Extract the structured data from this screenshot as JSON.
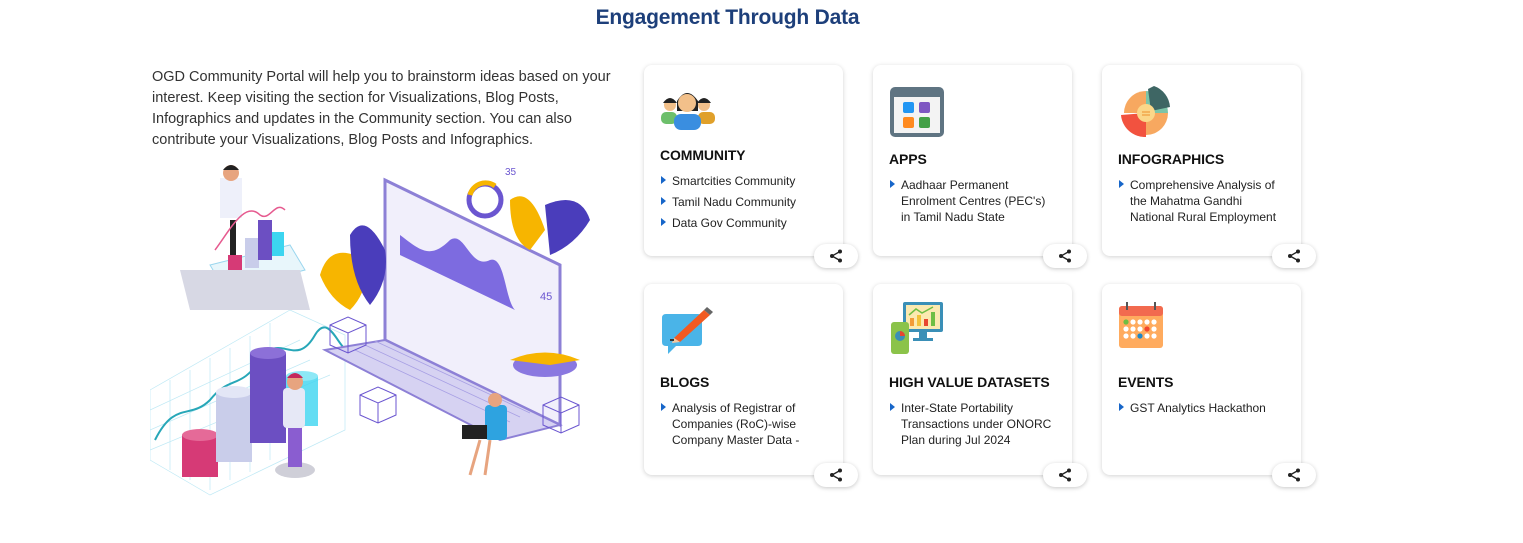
{
  "section": {
    "title": "Engagement Through Data",
    "intro": "OGD Community Portal will help you to brainstorm ideas based on your interest. Keep visiting the section for Visualizations, Blog Posts, Infographics and updates in the Community section. You can also contribute your Visualizations, Blog Posts and Infographics."
  },
  "illustration": {
    "labels": [
      "35",
      "45"
    ]
  },
  "cards": [
    {
      "title": "COMMUNITY",
      "icon": "community-icon",
      "items": [
        "Smartcities Community",
        "Tamil Nadu Community",
        "Data Gov Community"
      ]
    },
    {
      "title": "APPS",
      "icon": "apps-icon",
      "items": [
        "Aadhaar Permanent Enrolment Centres (PEC's) in Tamil Nadu State"
      ]
    },
    {
      "title": "INFOGRAPHICS",
      "icon": "infographics-icon",
      "items": [
        "Comprehensive Analysis of the Mahatma Gandhi National Rural Employment"
      ]
    },
    {
      "title": "BLOGS",
      "icon": "blogs-icon",
      "items": [
        "Analysis of Registrar of Companies (RoC)-wise Company Master Data -"
      ]
    },
    {
      "title": "HIGH VALUE DATASETS",
      "icon": "high-value-datasets-icon",
      "items": [
        "Inter-State Portability Transactions under ONORC Plan during Jul 2024"
      ]
    },
    {
      "title": "EVENTS",
      "icon": "events-icon",
      "items": [
        "GST Analytics Hackathon"
      ]
    }
  ],
  "share_icon": "share-icon",
  "colors": {
    "title": "#1d3f7a",
    "bullet": "#1766c9"
  }
}
